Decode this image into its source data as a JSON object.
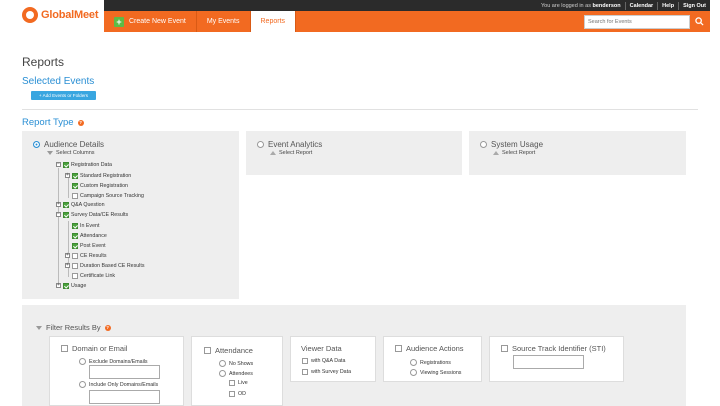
{
  "header": {
    "logged_in_prefix": "You are logged in as",
    "username": "benderson",
    "links": [
      "Calendar",
      "Help",
      "Sign Out"
    ],
    "logo_text": "GlobalMeet",
    "nav": [
      {
        "label": "Create New Event",
        "icon": "plus-icon"
      },
      {
        "label": "My Events"
      },
      {
        "label": "Reports",
        "active": true
      }
    ],
    "search_placeholder": "Search for Events"
  },
  "page_title": "Reports",
  "selected_events": {
    "title": "Selected Events",
    "add_button": "+ Add Events or Folders"
  },
  "report_type": {
    "title": "Report Type",
    "options": [
      {
        "label": "Audience Details",
        "selected": true,
        "sub_label": "Select Columns"
      },
      {
        "label": "Event Analytics",
        "selected": false,
        "sub_label": "Select Report"
      },
      {
        "label": "System Usage",
        "selected": false,
        "sub_label": "Select Report"
      }
    ],
    "tree": [
      {
        "label": "Registration Data",
        "checked": true,
        "expander": "minus"
      },
      {
        "label": "Standard Registration",
        "checked": true,
        "expander": "plus"
      },
      {
        "label": "Custom Registration",
        "checked": true
      },
      {
        "label": "Campaign Source Tracking",
        "checked": false
      },
      {
        "label": "Q&A Question",
        "checked": true,
        "expander": "plus"
      },
      {
        "label": "Survey Data/CE Results",
        "checked": true,
        "expander": "minus"
      },
      {
        "label": "In Event",
        "checked": true
      },
      {
        "label": "Attendance",
        "checked": true
      },
      {
        "label": "Post Event",
        "checked": true
      },
      {
        "label": "CE Results",
        "checked": false,
        "expander": "plus"
      },
      {
        "label": "Duration Based CE Results",
        "checked": false,
        "expander": "plus"
      },
      {
        "label": "Certificate Link",
        "checked": false
      },
      {
        "label": "Usage",
        "checked": true,
        "expander": "plus"
      }
    ]
  },
  "filter": {
    "title": "Filter Results By",
    "domain": {
      "title": "Domain or Email",
      "exclude": "Exclude Domains/Emails",
      "include": "Include Only Domains/Emails"
    },
    "attendance": {
      "title": "Attendance",
      "no_shows": "No Shows",
      "attendees": "Attendees",
      "live": "Live",
      "od": "OD"
    },
    "viewer": {
      "title": "Viewer Data",
      "qa": "with Q&A Data",
      "survey": "with Survey Data"
    },
    "audience": {
      "title": "Audience Actions",
      "registrations": "Registrations",
      "viewing": "Viewing Sessions"
    },
    "sti": {
      "title": "Source Track Identifier (STI)"
    }
  }
}
